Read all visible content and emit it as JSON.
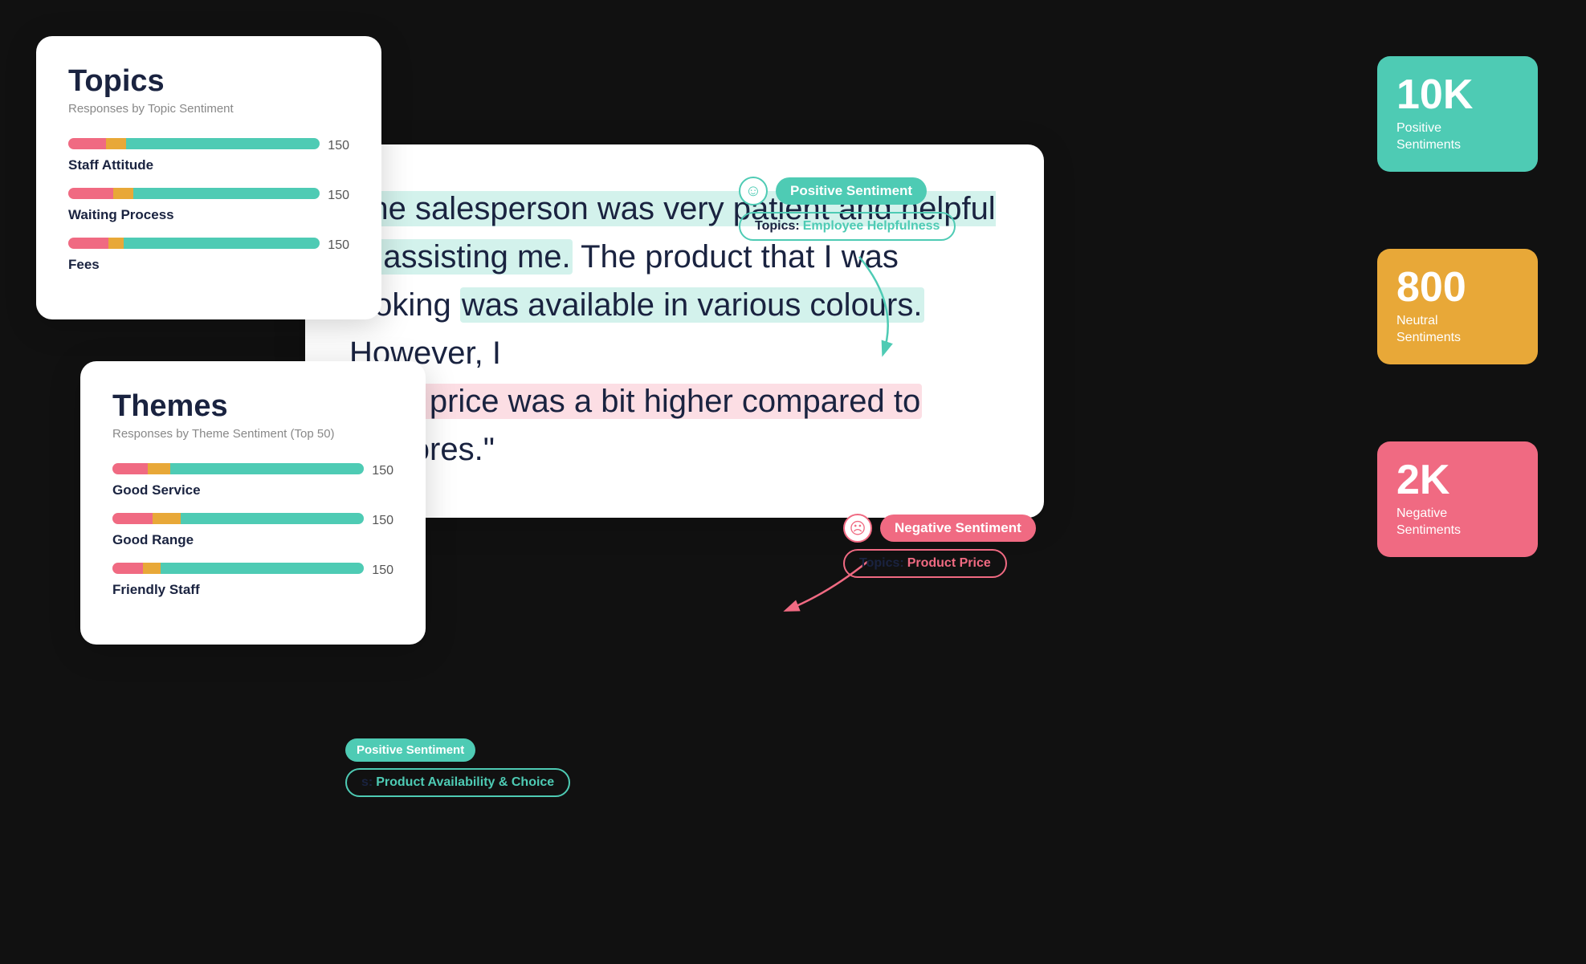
{
  "topics": {
    "title": "Topics",
    "subtitle": "Responses by Topic Sentiment",
    "items": [
      {
        "label": "Staff Attitude",
        "count": "150",
        "red": 15,
        "orange": 10,
        "teal": 75
      },
      {
        "label": "Waiting Process",
        "count": "150",
        "red": 18,
        "orange": 8,
        "teal": 74
      },
      {
        "label": "Fees",
        "count": "150",
        "red": 16,
        "orange": 6,
        "teal": 78
      }
    ]
  },
  "themes": {
    "title": "Themes",
    "subtitle": "Responses by Theme Sentiment (Top 50)",
    "items": [
      {
        "label": "Good Service",
        "count": "150",
        "red": 14,
        "orange": 10,
        "teal": 76
      },
      {
        "label": "Good Range",
        "count": "150",
        "red": 16,
        "orange": 12,
        "teal": 72
      },
      {
        "label": "Friendly Staff",
        "count": "150",
        "red": 12,
        "orange": 8,
        "teal": 80
      }
    ]
  },
  "review": {
    "text_part1": "The salesperson was very patient and helpful in assisting me.",
    "text_part2": " The product that I was looking was available in various colours.",
    "text_part3": " However, I",
    "text_part4": "k the price was a bit higher compared to",
    "text_part5": "er stores.\""
  },
  "annotations": {
    "positive1": {
      "badge": "Positive Sentiment",
      "topic_label": "Topics:",
      "topic_value": "Employee Helpfulness"
    },
    "positive2": {
      "badge": "Positive Sentiment",
      "topic_label": "s:",
      "topic_value": "Product Availability & Choice"
    },
    "negative1": {
      "badge": "Negative Sentiment",
      "topic_label": "Topics:",
      "topic_value": "Product Price"
    }
  },
  "stats": [
    {
      "number": "10K",
      "label": "Positive\nSentiments",
      "color": "teal"
    },
    {
      "number": "800",
      "label": "Neutral\nSentiments",
      "color": "orange"
    },
    {
      "number": "2K",
      "label": "Negative\nSentiments",
      "color": "pink"
    }
  ]
}
